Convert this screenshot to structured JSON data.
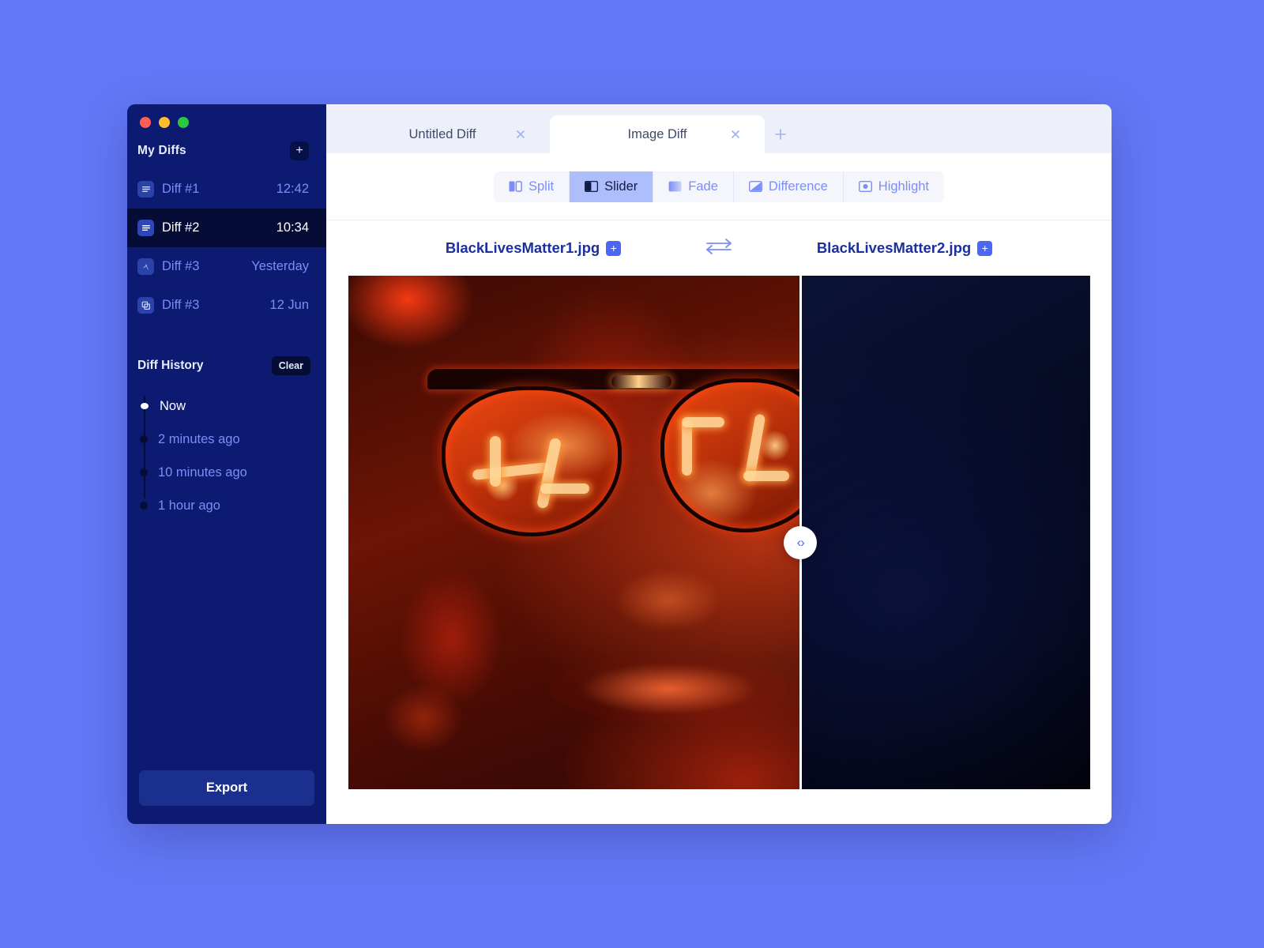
{
  "theme": {
    "desktop_background": "#6478f7",
    "sidebar_background": "#0c1a72",
    "sidebar_selected": "#050c36",
    "accent": "#4b67f3",
    "muted_blue_text": "#7b8ef5",
    "tabbar_background": "#edf0fa",
    "segment_active": "#aebdfb",
    "filename_color": "#1c2f9e"
  },
  "window": {
    "traffic_lights": [
      {
        "name": "close",
        "color": "#ff5f52"
      },
      {
        "name": "minimize",
        "color": "#ffbd2e"
      },
      {
        "name": "zoom",
        "color": "#28c840"
      }
    ]
  },
  "sidebar": {
    "title": "My Diffs",
    "add_button_label": "+",
    "diffs": [
      {
        "icon": "document-lines-icon",
        "label": "Diff #1",
        "time": "12:42",
        "selected": false
      },
      {
        "icon": "document-lines-icon",
        "label": "Diff #2",
        "time": "10:34",
        "selected": true
      },
      {
        "icon": "pdf-file-icon",
        "label": "Diff #3",
        "time": "Yesterday",
        "selected": false
      },
      {
        "icon": "layers-icon",
        "label": "Diff #3",
        "time": "12 Jun",
        "selected": false
      }
    ],
    "history": {
      "title": "Diff History",
      "clear_label": "Clear",
      "entries": [
        {
          "label": "Now",
          "current": true
        },
        {
          "label": "2 minutes ago",
          "current": false
        },
        {
          "label": "10 minutes ago",
          "current": false
        },
        {
          "label": "1 hour ago",
          "current": false
        }
      ]
    },
    "export_label": "Export"
  },
  "tabs": {
    "items": [
      {
        "label": "Untitled Diff",
        "active": false,
        "close_icon": "close-icon"
      },
      {
        "label": "Image Diff",
        "active": true,
        "close_icon": "close-icon"
      }
    ],
    "new_tab_label": "+"
  },
  "modes": {
    "items": [
      {
        "label": "Split",
        "icon": "split-panes-icon",
        "active": false
      },
      {
        "label": "Slider",
        "icon": "slider-split-icon",
        "active": true
      },
      {
        "label": "Fade",
        "icon": "fade-gradient-icon",
        "active": false
      },
      {
        "label": "Difference",
        "icon": "diagonal-split-icon",
        "active": false
      },
      {
        "label": "Highlight",
        "icon": "highlight-dot-icon",
        "active": false
      }
    ],
    "selected": "Slider"
  },
  "files": {
    "left": {
      "name": "BlackLivesMatter1.jpg",
      "add_label": "+"
    },
    "right": {
      "name": "BlackLivesMatter2.jpg",
      "add_label": "+"
    },
    "swap_icon": "swap-arrows-icon"
  },
  "comparison": {
    "slider_position_percent": 61,
    "handle_glyph": "‹›",
    "left_image_alt": "Portrait in red neon light with glasses reflecting neon letters",
    "right_image_alt": "Same portrait in dark blue light"
  }
}
